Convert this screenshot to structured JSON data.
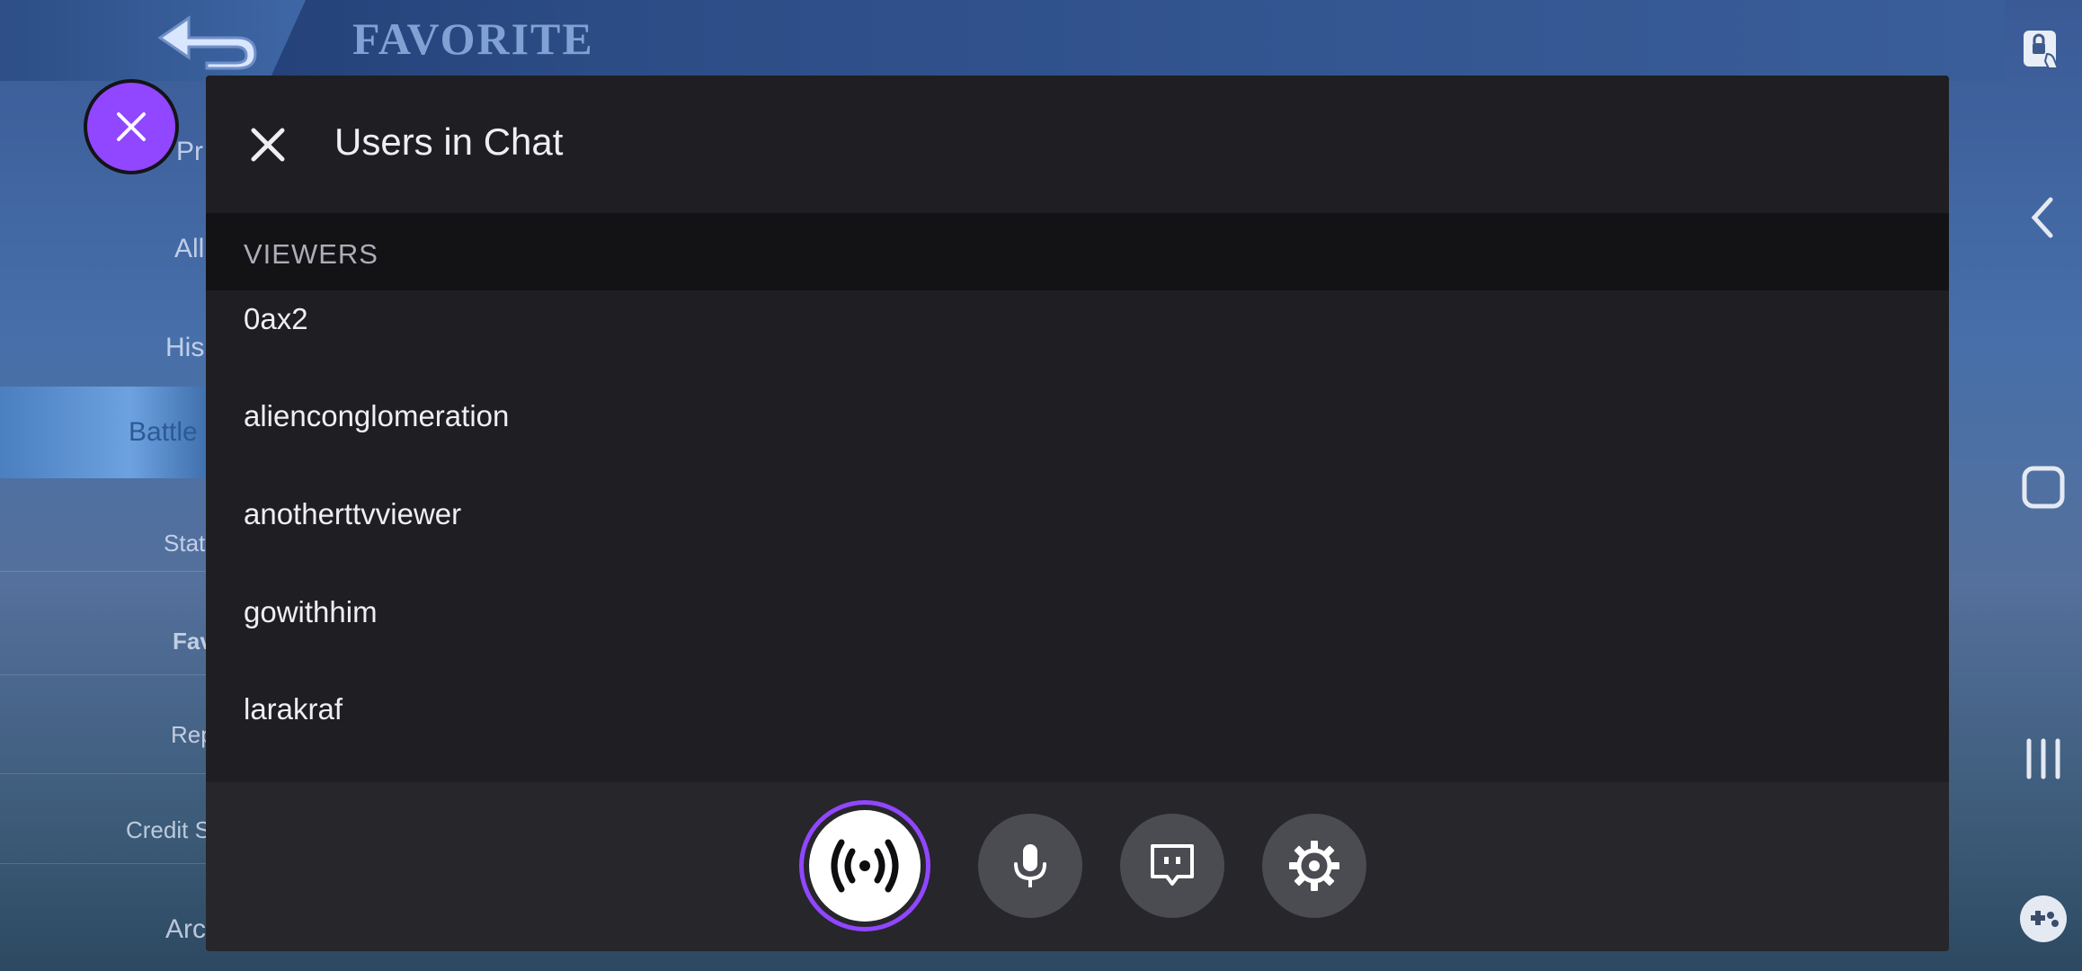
{
  "game": {
    "title": "FAVORITE",
    "menu": [
      "Pr",
      "All",
      "His",
      "Battle",
      "Stat",
      "Fav",
      "Rep",
      "Credit S",
      "Arc"
    ]
  },
  "chat": {
    "title": "Users in Chat",
    "section_label": "VIEWERS",
    "viewers": [
      "0ax2",
      "alienconglomeration",
      "anotherttvviewer",
      "gowithhim",
      "larakraf"
    ]
  },
  "icons": {
    "bubble": "close-icon",
    "panel_close": "close-icon",
    "live": "broadcast-icon",
    "mic": "microphone-icon",
    "chat": "chat-bubble-icon",
    "settings": "gear-icon",
    "nav": [
      "screen-lock-icon",
      "back-chevron-icon",
      "home-icon",
      "recents-icon",
      "game-tools-icon"
    ]
  },
  "colors": {
    "accent": "#9146ff",
    "panel_bg": "#1f1f23",
    "section_bg": "#131316",
    "footer_bg": "#26262b",
    "control_bg": "#4b4b52"
  }
}
